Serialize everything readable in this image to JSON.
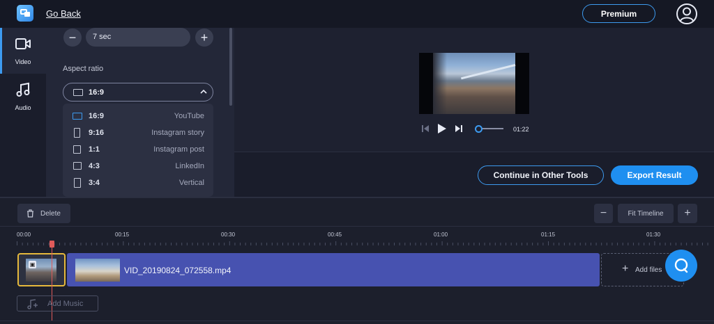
{
  "header": {
    "go_back": "Go Back",
    "premium": "Premium",
    "logo_icon": "app-logo-icon",
    "user_icon": "user-account-icon"
  },
  "nav": {
    "items": [
      {
        "label": "Video",
        "icon": "video-camera-icon",
        "active": true
      },
      {
        "label": "Audio",
        "icon": "music-note-icon",
        "active": false
      }
    ]
  },
  "settings": {
    "duration_value": "7 sec",
    "aspect_label": "Aspect ratio",
    "aspect_selected": "16:9",
    "aspect_options": [
      {
        "ratio": "16:9",
        "name": "YouTube",
        "selected": true
      },
      {
        "ratio": "9:16",
        "name": "Instagram story",
        "selected": false
      },
      {
        "ratio": "1:1",
        "name": "Instagram post",
        "selected": false
      },
      {
        "ratio": "4:3",
        "name": "LinkedIn",
        "selected": false
      },
      {
        "ratio": "3:4",
        "name": "Vertical",
        "selected": false
      }
    ]
  },
  "player": {
    "time": "01:22",
    "progress": 0.0
  },
  "actions": {
    "continue": "Continue in Other Tools",
    "export": "Export Result"
  },
  "timeline": {
    "delete": "Delete",
    "fit": "Fit Timeline",
    "ticks": [
      "00:00",
      "00:15",
      "00:30",
      "00:45",
      "01:00",
      "01:15",
      "01:30"
    ],
    "clip_name": "VID_20190824_072558.mp4",
    "add_files": "Add files",
    "add_music": "Add Music"
  },
  "colors": {
    "accent": "#1f8ff0",
    "track": "#4752b0",
    "playhead": "#e05a5a",
    "selection": "#e6b93c"
  }
}
